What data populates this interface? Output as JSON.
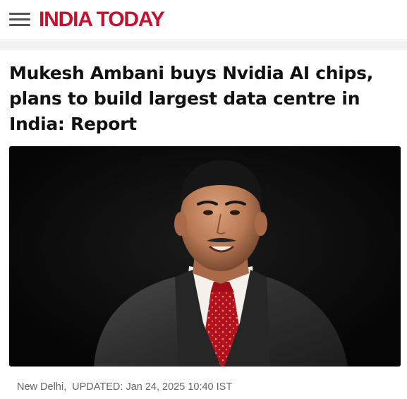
{
  "header": {
    "brand": "INDIA TODAY",
    "brand_color": "#c8102e",
    "menu_icon": "hamburger-menu-icon"
  },
  "article": {
    "headline": "Mukesh Ambani buys Nvidia AI chips, plans to build largest data centre in India: Report",
    "image_alt": "Photo of Mukesh Ambani in a dark suit and red patterned tie against a black background",
    "location": "New Delhi",
    "updated_label": "UPDATED:",
    "updated_time": "Jan 24, 2025 10:40 IST"
  }
}
